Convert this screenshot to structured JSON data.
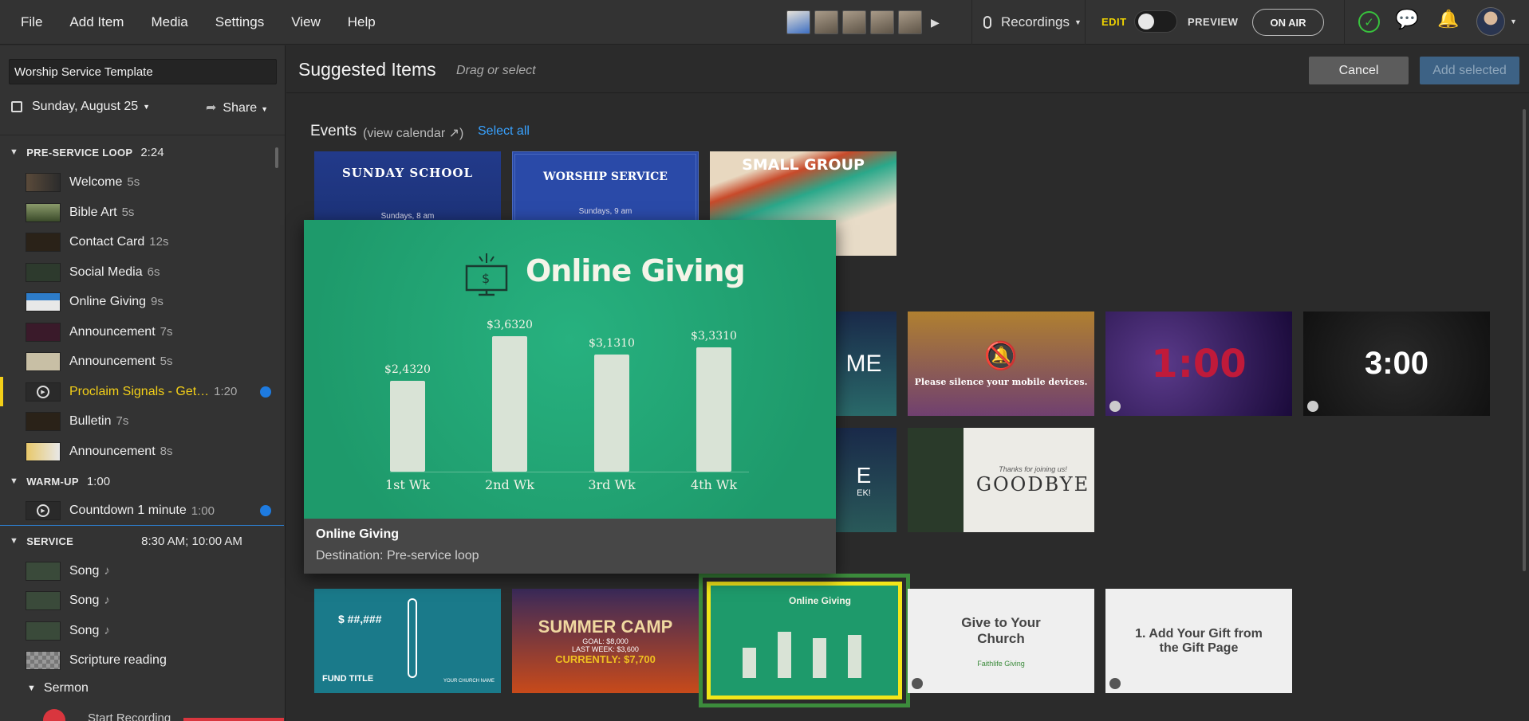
{
  "menu": [
    "File",
    "Add Item",
    "Media",
    "Settings",
    "View",
    "Help"
  ],
  "recordings": {
    "label": "Recordings"
  },
  "mode": {
    "edit": "EDIT",
    "preview": "PREVIEW",
    "on_air": "ON AIR"
  },
  "sidebar": {
    "template_name": "Worship Service Template",
    "date": "Sunday, August 25",
    "share": "Share",
    "sections": [
      {
        "name": "PRE-SERVICE LOOP",
        "duration": "2:24"
      },
      {
        "name": "WARM-UP",
        "duration": "1:00"
      },
      {
        "name": "SERVICE",
        "duration": "8:30 AM; 10:00 AM"
      }
    ],
    "preservice_items": [
      {
        "label": "Welcome",
        "dur": "5s"
      },
      {
        "label": "Bible Art",
        "dur": "5s"
      },
      {
        "label": "Contact Card",
        "dur": "12s"
      },
      {
        "label": "Social Media",
        "dur": "6s"
      },
      {
        "label": "Online Giving",
        "dur": "9s"
      },
      {
        "label": "Announcement",
        "dur": "7s"
      },
      {
        "label": "Announcement",
        "dur": "5s"
      },
      {
        "label": "Proclaim Signals - Get…",
        "dur": "1:20"
      },
      {
        "label": "Bulletin",
        "dur": "7s"
      },
      {
        "label": "Announcement",
        "dur": "8s"
      }
    ],
    "warmup_items": [
      {
        "label": "Countdown 1 minute",
        "dur": "1:00"
      }
    ],
    "service_items": [
      {
        "label": "Song",
        "dur": "♪"
      },
      {
        "label": "Song",
        "dur": "♪"
      },
      {
        "label": "Song",
        "dur": "♪"
      },
      {
        "label": "Scripture reading",
        "dur": ""
      }
    ],
    "sermon": "Sermon",
    "start_recording": "Start Recording"
  },
  "main": {
    "title": "Suggested Items",
    "subtitle": "Drag or select",
    "cancel": "Cancel",
    "add_selected": "Add selected",
    "events_label": "Events",
    "view_calendar": "(view calendar",
    "select_all": "Select all",
    "event_cards": [
      {
        "title": "SUNDAY SCHOOL",
        "sub": "Sundays, 8 am"
      },
      {
        "title": "WORSHIP SERVICE",
        "sub": "Sundays, 9 am"
      },
      {
        "title": "SMALL GROUP",
        "sub": ""
      }
    ],
    "row2_cards": [
      {
        "title": "ME"
      },
      {
        "title": "Please silence your mobile devices."
      },
      {
        "title": "1:00"
      },
      {
        "title": "3:00"
      }
    ],
    "row3_cards": [
      {
        "title": "E",
        "sub": "EK!"
      },
      {
        "title": "GOODBYE",
        "sub": "Thanks for joining us!"
      }
    ],
    "giving_cards": [
      {
        "title": "$ ##,###",
        "sub": "FUND TITLE",
        "sub2": "YOUR CHURCH NAME"
      },
      {
        "title": "SUMMER CAMP",
        "sub": "GOAL: $8,000",
        "sub2": "LAST WEEK: $3,600",
        "sub3": "CURRENTLY: $7,700"
      },
      {
        "title": "Online Giving"
      },
      {
        "title": "Give to Your Church",
        "sub": "Faithlife Giving"
      },
      {
        "title": "1. Add Your Gift from the Gift Page"
      }
    ],
    "section_label_giving": "Online Giving"
  },
  "popup": {
    "slide_title": "Online Giving",
    "bars": [
      {
        "label": "1st Wk",
        "value": "$2,4320",
        "amount": 24320
      },
      {
        "label": "2nd Wk",
        "value": "$3,6320",
        "amount": 36320
      },
      {
        "label": "3rd Wk",
        "value": "$3,1310",
        "amount": 31310
      },
      {
        "label": "4th Wk",
        "value": "$3,3310",
        "amount": 33310
      }
    ],
    "name": "Online Giving",
    "destination": "Destination: Pre-service loop"
  },
  "colors": {
    "accent": "#38a2ff",
    "active": "#f3cf18",
    "slide_green": "#1e9a6b",
    "edit_yellow": "#f0d400",
    "ok_green": "#38c23d"
  }
}
